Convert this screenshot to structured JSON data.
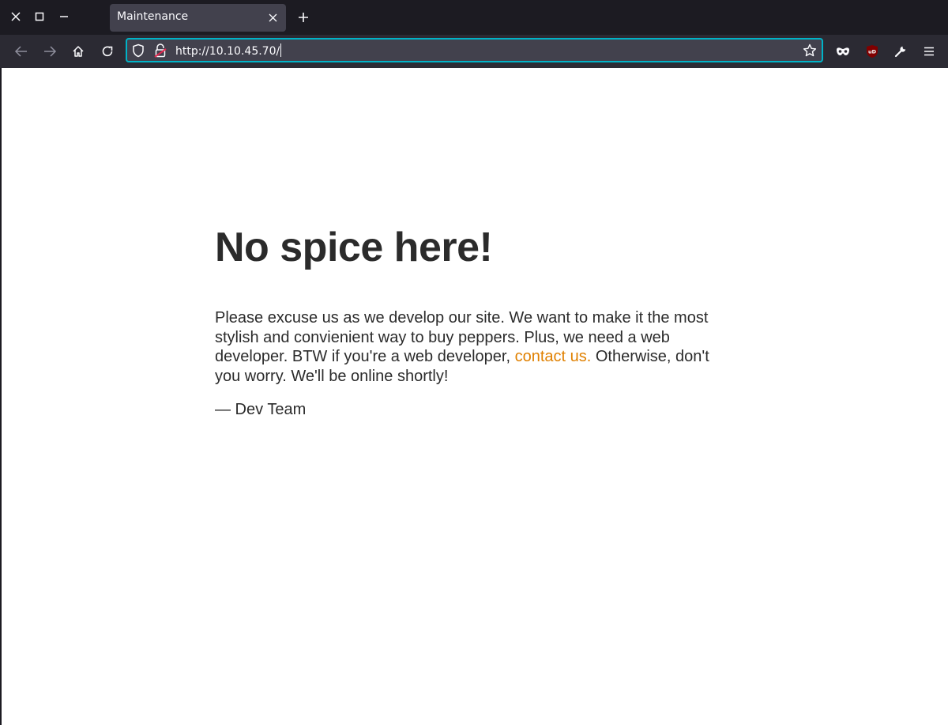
{
  "browser": {
    "tab_title": "Maintenance",
    "url": "http://10.10.45.70/"
  },
  "page": {
    "headline": "No spice here!",
    "paragraph_before_link": "Please excuse us as we develop our site. We want to make it the most stylish and convienient way to buy peppers. Plus, we need a web developer. BTW if you're a web developer, ",
    "link_text": "contact us.",
    "paragraph_after_link": " Otherwise, don't you worry. We'll be online shortly!",
    "signature": "— Dev Team"
  },
  "colors": {
    "link": "#e08000",
    "text": "#2b2b2b",
    "urlbar_focus_border": "#00b3c7",
    "ublock_badge": "#800000"
  },
  "icons": [
    "close-window-icon",
    "maximize-window-icon",
    "minimize-window-icon",
    "tab-close-icon",
    "new-tab-icon",
    "back-icon",
    "forward-icon",
    "home-icon",
    "reload-icon",
    "shield-icon",
    "insecure-lock-icon",
    "bookmark-star-icon",
    "private-mask-icon",
    "ublock-icon",
    "wrench-icon",
    "hamburger-menu-icon"
  ]
}
